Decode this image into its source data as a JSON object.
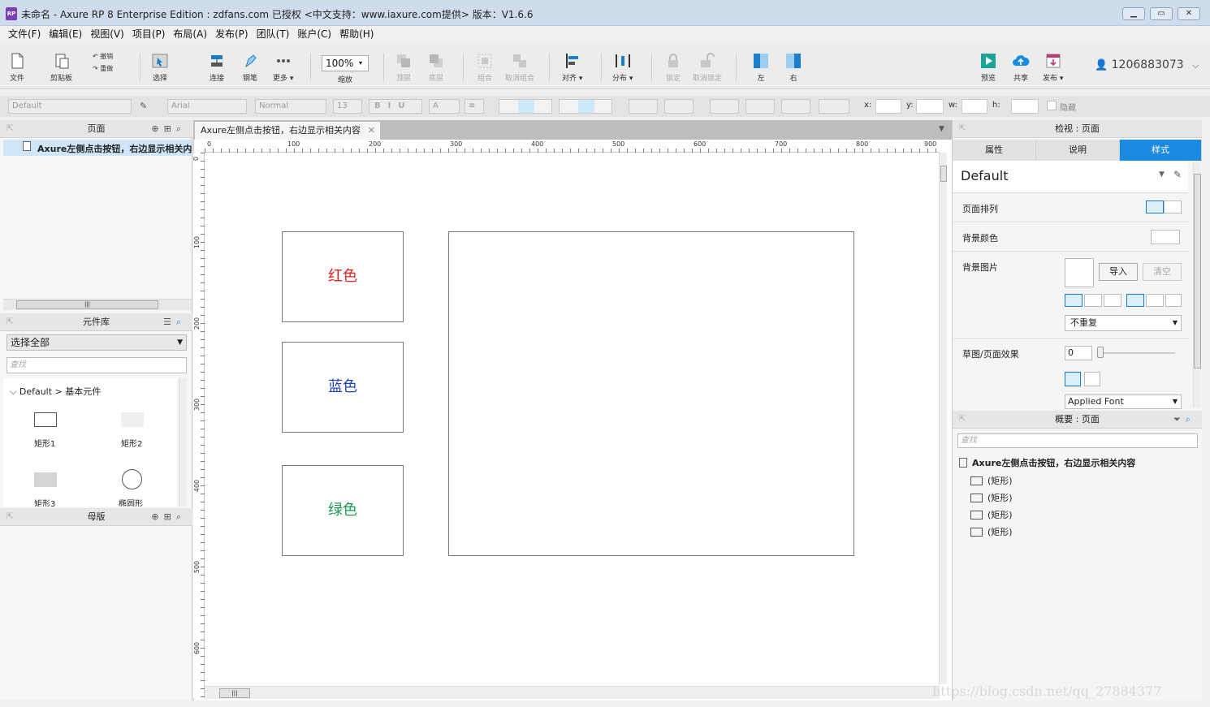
{
  "window": {
    "title": "未命名 - Axure RP 8 Enterprise Edition : zdfans.com 已授权     <中文支持：www.iaxure.com提供> 版本：V1.6.6",
    "logo_text": "RP",
    "buttons": [
      "minimize",
      "maximize",
      "close"
    ]
  },
  "menu": [
    "文件(F)",
    "编辑(E)",
    "视图(V)",
    "项目(P)",
    "布局(A)",
    "发布(P)",
    "团队(T)",
    "账户(C)",
    "帮助(H)"
  ],
  "toolbar": {
    "file": "文件",
    "clipboard": "剪贴板",
    "undo": "撤销",
    "redo": "重做",
    "select": "选择",
    "connect": "连接",
    "pen": "钢笔",
    "more": "更多 ▾",
    "zoom_value": "100%",
    "zoom_label": "缩放",
    "top": "顶层",
    "bottom": "底层",
    "group": "组合",
    "ungroup": "取消组合",
    "align": "对齐 ▾",
    "distribute": "分布 ▾",
    "lock": "锁定",
    "unlock": "取消锁定",
    "left": "左",
    "right": "右",
    "preview": "预览",
    "share": "共享",
    "publish": "发布 ▾",
    "user": "1206883073"
  },
  "formatbar": {
    "style": "Default",
    "font": "Arial",
    "weight": "Normal",
    "size": "13",
    "x_label": "x:",
    "y_label": "y:",
    "w_label": "w:",
    "h_label": "h:",
    "hidden_label": "隐藏"
  },
  "pages_panel": {
    "title": "页面",
    "page": "Axure左侧点击按钮，右边显示相关内容"
  },
  "library_panel": {
    "title": "元件库",
    "select": "选择全部",
    "search_placeholder": "查找",
    "group": "Default > 基本元件",
    "items": [
      "矩形1",
      "矩形2",
      "矩形3",
      "椭圆形"
    ]
  },
  "masters_panel": {
    "title": "母版"
  },
  "canvas": {
    "tab": "Axure左侧点击按钮，右边显示相关内容",
    "ruler_h": [
      "0",
      "100",
      "200",
      "300",
      "400",
      "500",
      "600",
      "700",
      "800",
      "900"
    ],
    "ruler_v": [
      "0",
      "100",
      "200",
      "300",
      "400",
      "500",
      "600"
    ],
    "buttons": [
      {
        "label": "红色",
        "color": "#e02020"
      },
      {
        "label": "蓝色",
        "color": "#2040c8"
      },
      {
        "label": "绿色",
        "color": "#1a9a50"
      }
    ]
  },
  "inspector": {
    "title": "检视 : 页面",
    "tabs": [
      "属性",
      "说明",
      "样式"
    ],
    "active_tab_color": "#1a8be0",
    "style_name": "Default",
    "page_align": "页面排列",
    "bg_color": "背景颜色",
    "bg_image": "背景图片",
    "import": "导入",
    "clear": "清空",
    "repeat": "不重复",
    "sketch": "草图/页面效果",
    "sketch_value": "0",
    "font": "Applied Font"
  },
  "outline": {
    "title": "概要 : 页面",
    "search_placeholder": "查找",
    "page": "Axure左侧点击按钮，右边显示相关内容",
    "items": [
      "(矩形)",
      "(矩形)",
      "(矩形)",
      "(矩形)"
    ]
  },
  "watermark": "https://blog.csdn.net/qq_27884377"
}
